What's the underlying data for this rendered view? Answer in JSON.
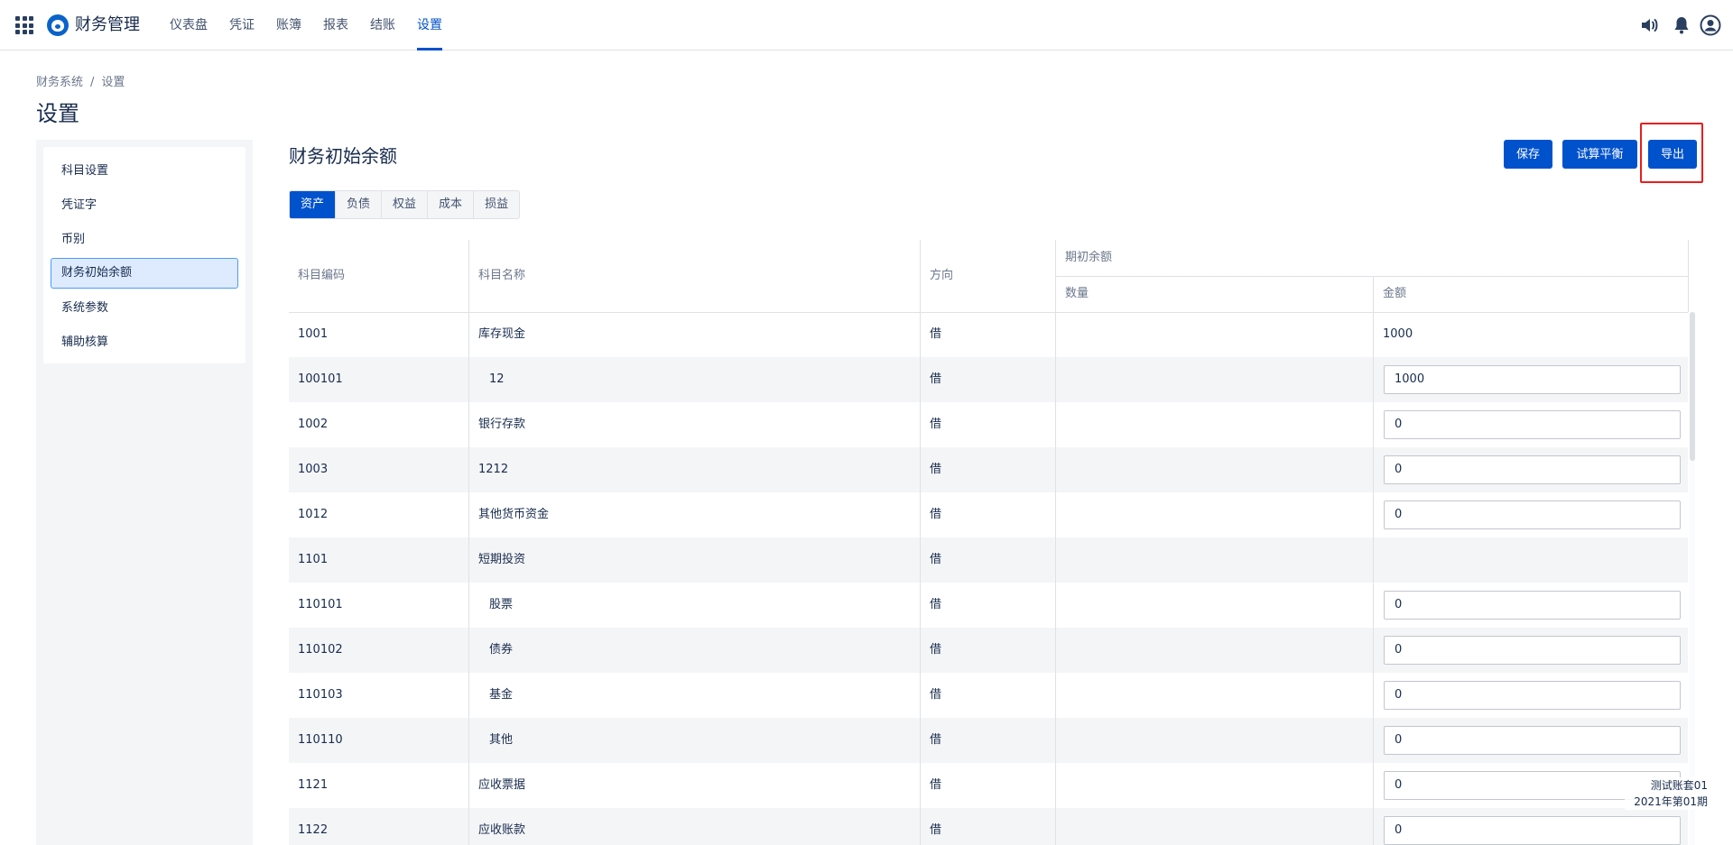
{
  "app": {
    "title": "财务管理",
    "nav": [
      {
        "label": "仪表盘",
        "active": false
      },
      {
        "label": "凭证",
        "active": false
      },
      {
        "label": "账簿",
        "active": false
      },
      {
        "label": "报表",
        "active": false
      },
      {
        "label": "结账",
        "active": false
      },
      {
        "label": "设置",
        "active": true
      }
    ],
    "icons": [
      "apps-grid-icon",
      "logo-icon",
      "speaker-icon",
      "bell-icon",
      "user-avatar-icon"
    ],
    "accent_color": "#0052cc"
  },
  "breadcrumb": [
    "财务系统",
    "/",
    "设置"
  ],
  "page_title": "设置",
  "sidebar": {
    "items": [
      {
        "label": "科目设置",
        "active": false
      },
      {
        "label": "凭证字",
        "active": false
      },
      {
        "label": "币别",
        "active": false
      },
      {
        "label": "财务初始余额",
        "active": true
      },
      {
        "label": "系统参数",
        "active": false
      },
      {
        "label": "辅助核算",
        "active": false
      }
    ]
  },
  "section": {
    "title": "财务初始余额",
    "buttons": {
      "save": "保存",
      "trial_balance": "试算平衡",
      "export": "导出"
    },
    "tabs": [
      {
        "label": "资产",
        "active": true
      },
      {
        "label": "负债",
        "active": false
      },
      {
        "label": "权益",
        "active": false
      },
      {
        "label": "成本",
        "active": false
      },
      {
        "label": "损益",
        "active": false
      }
    ]
  },
  "table": {
    "headers": {
      "code": "科目编码",
      "name": "科目名称",
      "direction": "方向",
      "opening_balance": "期初余额",
      "quantity": "数量",
      "amount": "金额"
    },
    "rows": [
      {
        "code": "1001",
        "name": "库存现金",
        "indent": false,
        "direction": "借",
        "quantity": "",
        "amount": "1000",
        "amount_editable": false
      },
      {
        "code": "100101",
        "name": "12",
        "indent": true,
        "direction": "借",
        "quantity": "",
        "amount": "1000",
        "amount_editable": true
      },
      {
        "code": "1002",
        "name": "银行存款",
        "indent": false,
        "direction": "借",
        "quantity": "",
        "amount": "0",
        "amount_editable": true
      },
      {
        "code": "1003",
        "name": "1212",
        "indent": false,
        "direction": "借",
        "quantity": "",
        "amount": "0",
        "amount_editable": true
      },
      {
        "code": "1012",
        "name": "其他货币资金",
        "indent": false,
        "direction": "借",
        "quantity": "",
        "amount": "0",
        "amount_editable": true
      },
      {
        "code": "1101",
        "name": "短期投资",
        "indent": false,
        "direction": "借",
        "quantity": "",
        "amount": "",
        "amount_editable": false
      },
      {
        "code": "110101",
        "name": "股票",
        "indent": true,
        "direction": "借",
        "quantity": "",
        "amount": "0",
        "amount_editable": true
      },
      {
        "code": "110102",
        "name": "债券",
        "indent": true,
        "direction": "借",
        "quantity": "",
        "amount": "0",
        "amount_editable": true
      },
      {
        "code": "110103",
        "name": "基金",
        "indent": true,
        "direction": "借",
        "quantity": "",
        "amount": "0",
        "amount_editable": true
      },
      {
        "code": "110110",
        "name": "其他",
        "indent": true,
        "direction": "借",
        "quantity": "",
        "amount": "0",
        "amount_editable": true
      },
      {
        "code": "1121",
        "name": "应收票据",
        "indent": false,
        "direction": "借",
        "quantity": "",
        "amount": "0",
        "amount_editable": true
      },
      {
        "code": "1122",
        "name": "应收账款",
        "indent": false,
        "direction": "借",
        "quantity": "",
        "amount": "0",
        "amount_editable": true
      }
    ]
  },
  "footer": {
    "account_set": "测试账套01",
    "period": "2021年第01期"
  }
}
